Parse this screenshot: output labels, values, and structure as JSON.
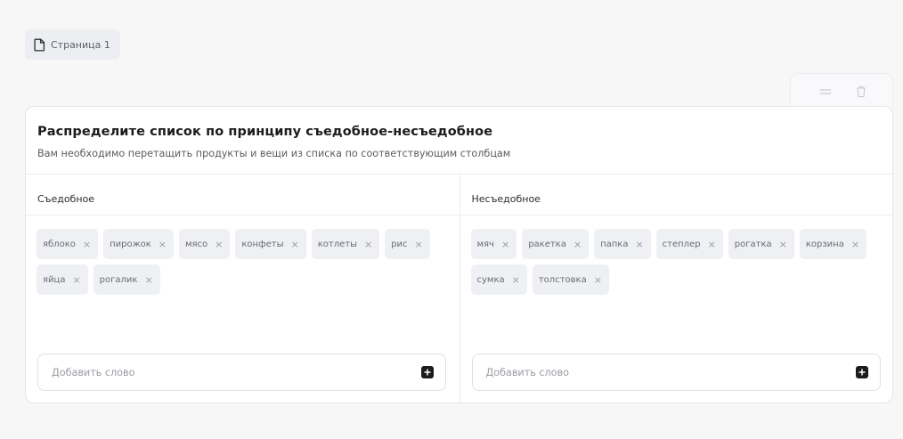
{
  "page_tab": {
    "label": "Страница 1",
    "icon": "page-icon"
  },
  "toolbar": {
    "drag_icon": "drag-handle-icon",
    "delete_icon": "trash-icon"
  },
  "task": {
    "title": "Распределите список по принципу съедобное-несъедобное",
    "subtitle": "Вам необходимо перетащить продукты и вещи из списка по соответствующим столбцам"
  },
  "columns": [
    {
      "title": "Съедобное",
      "items": [
        "яблоко",
        "пирожок",
        "мясо",
        "конфеты",
        "котлеты",
        "рис",
        "яйца",
        "рогалик"
      ],
      "input_placeholder": "Добавить слово"
    },
    {
      "title": "Несъедобное",
      "items": [
        "мяч",
        "ракетка",
        "папка",
        "степлер",
        "рогатка",
        "корзина",
        "сумка",
        "толстовка"
      ],
      "input_placeholder": "Добавить слово"
    }
  ],
  "chip_remove_symbol": "×"
}
